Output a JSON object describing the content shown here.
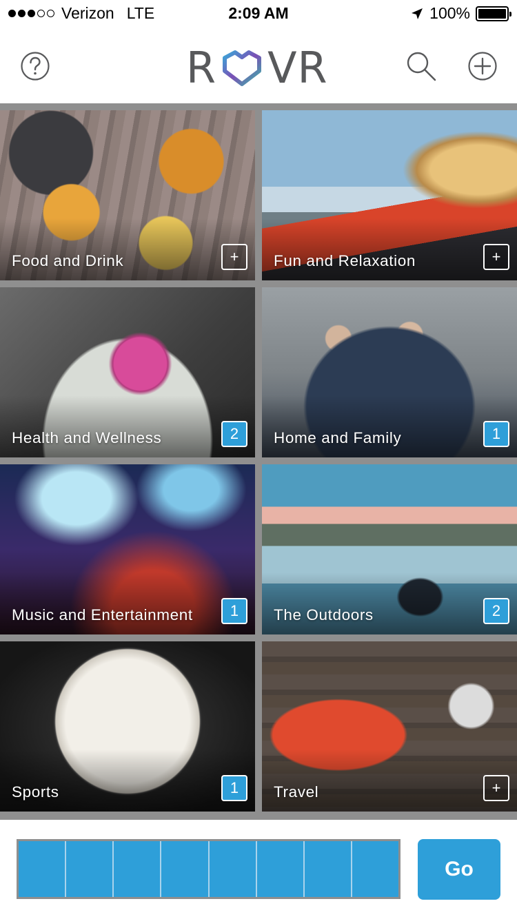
{
  "status_bar": {
    "carrier": "Verizon",
    "network": "LTE",
    "time": "2:09 AM",
    "battery": "100%",
    "signal_filled": 3,
    "signal_total": 5
  },
  "header": {
    "logo_text_left": "R",
    "logo_text_right": "VR",
    "icons": [
      "help-icon",
      "search-icon",
      "add-icon"
    ]
  },
  "categories": [
    {
      "label": "Food and Drink",
      "badge": "+"
    },
    {
      "label": "Fun and Relaxation",
      "badge": "+"
    },
    {
      "label": "Health and Wellness",
      "badge": "2"
    },
    {
      "label": "Home and Family",
      "badge": "1"
    },
    {
      "label": "Music and Entertainment",
      "badge": "1"
    },
    {
      "label": "The Outdoors",
      "badge": "2"
    },
    {
      "label": "Sports",
      "badge": "1"
    },
    {
      "label": "Travel",
      "badge": "+"
    }
  ],
  "selection": {
    "slot_count": 8
  },
  "actions": {
    "go_label": "Go"
  },
  "colors": {
    "accent": "#2e9fd9",
    "grid_divider": "#8f8f8f",
    "logo_gray": "#58595b"
  }
}
